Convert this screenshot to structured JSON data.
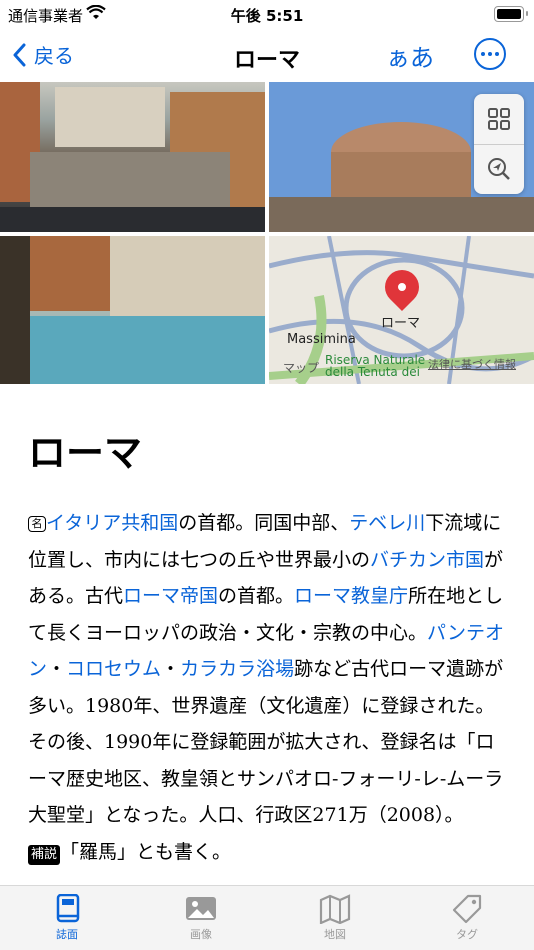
{
  "status": {
    "carrier": "通信事業者",
    "time": "午後 5:51"
  },
  "nav": {
    "back_label": "戻る",
    "title": "ローマ",
    "text_size_label": "ぁあ"
  },
  "map": {
    "pin_label": "ローマ",
    "place_label": "Massimina",
    "reserve_label": "Riserva Naturale della Tenuta dei Massimi",
    "maps_label": "マップ",
    "legal_label": "法律に基づく情報"
  },
  "article": {
    "heading": "ローマ",
    "p1_mark": "名",
    "seg": [
      "イタリア共和国",
      "の首都。同国中部、",
      "テベレ川",
      "下流域に位置し、市内には七つの丘や世界最小の",
      "バチカン市国",
      "がある。古代",
      "ローマ帝国",
      "の首都。",
      "ローマ教皇庁",
      "所在地として長くヨーロッパの政治・文化・宗教の中心。",
      "パンテオン",
      "・",
      "コロセウム",
      "・",
      "カラカラ浴場",
      "跡など古代ローマ遺跡が多い。1980年、世界遺産（文化遺産）に登録された。その後、1990年に登録範囲が拡大され、登録名は「ローマ歴史地区、教皇領とサンパオロ-フォーリ-レ-ムーラ大聖堂」となった。人口、行政区271万（2008）。"
    ],
    "note_tag": "補説",
    "note_text": "「羅馬」とも書く。"
  },
  "tabs": [
    {
      "label": "誌面",
      "icon": "book-icon"
    },
    {
      "label": "画像",
      "icon": "photo-icon"
    },
    {
      "label": "地図",
      "icon": "map-icon"
    },
    {
      "label": "タグ",
      "icon": "tag-icon"
    }
  ],
  "colors": {
    "accent": "#0a64d8",
    "pin": "#e0353a"
  }
}
